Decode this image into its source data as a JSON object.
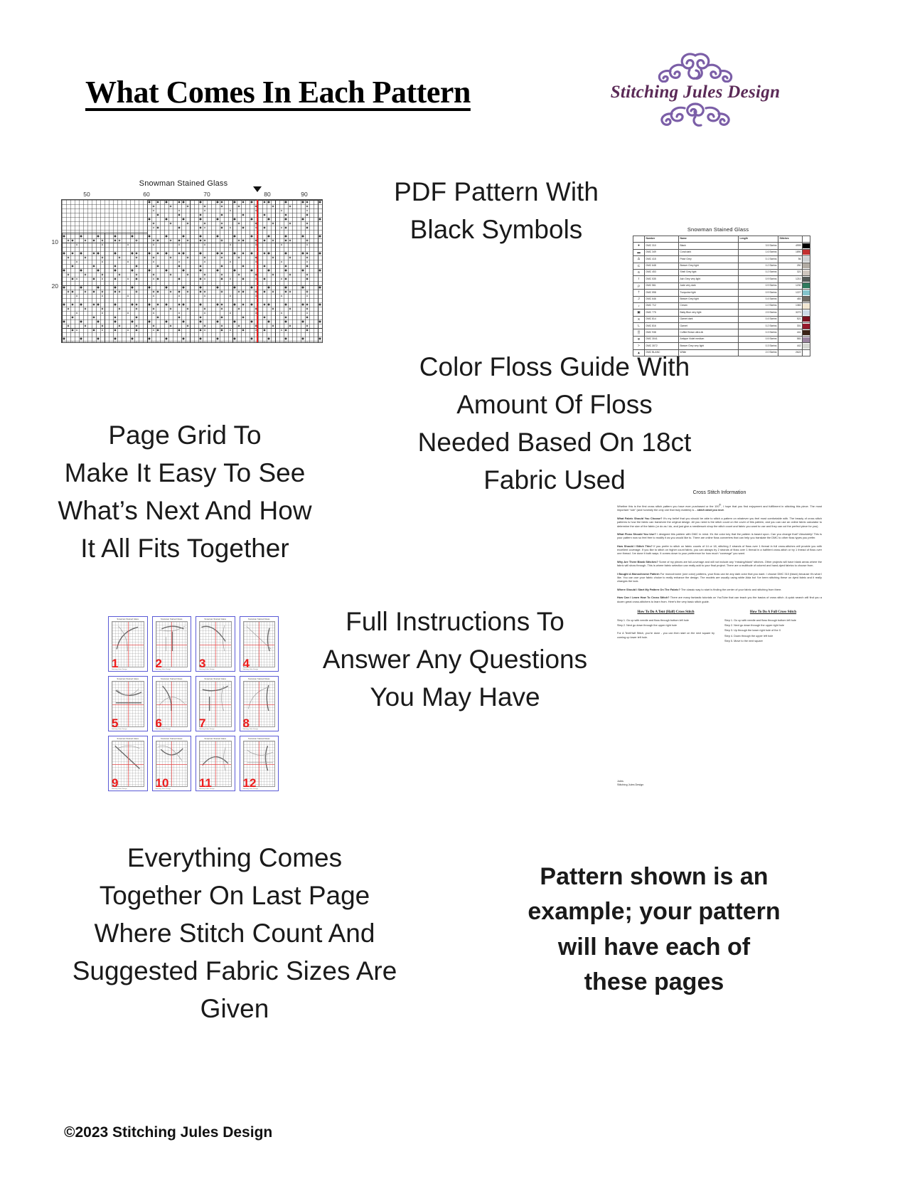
{
  "header": {
    "title": "What Comes In Each Pattern",
    "logo_text": "Stitching Jules Design",
    "logo_color": "#5b2a57",
    "swirl_color": "#7b5ea7"
  },
  "callouts": {
    "pdf_pattern": "PDF Pattern With\nBlack Symbols",
    "page_grid": "Page Grid To\nMake It Easy To See\nWhat’s Next And How\nIt All Fits Together",
    "color_floss": "Color Floss Guide With\nAmount Of Floss\nNeeded Based On 18ct\nFabric Used",
    "full_instructions": "Full Instructions To\nAnswer Any Questions\nYou May Have",
    "everything_comes": "Everything Comes\nTogether On Last Page\nWhere Stitch Count And\nSuggested Fabric Sizes Are\nGiven",
    "disclaimer": "Pattern shown is an\nexample; your pattern\nwill have each of\nthese pages"
  },
  "chart": {
    "title": "Snowman Stained Glass",
    "x_ticks": [
      "50",
      "60",
      "70",
      "80",
      "90"
    ],
    "y_ticks": [
      "10",
      "20"
    ],
    "center_line_color": "#ee1c1c",
    "center_marker_label": "center-marker"
  },
  "floss_table": {
    "title": "Snowman Stained Glass",
    "columns": [
      "",
      "Number",
      "Name",
      "Length",
      "Stitches",
      ""
    ],
    "rows": [
      {
        "symbol": "●",
        "number": "DMC   310",
        "name": "Black",
        "length": "3.5 Skeins",
        "stitches": "4999",
        "color": "#000000"
      },
      {
        "symbol": "▬",
        "number": "DMC   349",
        "name": "Coral dark",
        "length": "1.6 Skeins",
        "stitches": "1890",
        "color": "#c23030"
      },
      {
        "symbol": "∆",
        "number": "DMC   415",
        "name": "Pearl Grey",
        "length": "0.1 Skeins",
        "stitches": "56",
        "color": "#cfd2d4"
      },
      {
        "symbol": "C",
        "number": "DMC   648",
        "name": "Beaver Grey light",
        "length": "0.2 Skeins",
        "stitches": "250",
        "color": "#b2aca4"
      },
      {
        "symbol": "6",
        "number": "DMC   453",
        "name": "Shell Grey light",
        "length": "0.2 Skeins",
        "stitches": "321",
        "color": "#cfc6bf"
      },
      {
        "symbol": "I",
        "number": "DMC   535",
        "name": "Ash Grey very light",
        "length": "0.9 Skeins",
        "stitches": "1210",
        "color": "#555a58"
      },
      {
        "symbol": "ρ",
        "number": "DMC   561",
        "name": "Jade very dark",
        "length": "0.9 Skeins",
        "stitches": "1230",
        "color": "#2f7a5e"
      },
      {
        "symbol": "†",
        "number": "DMC   598",
        "name": "Turquoise light",
        "length": "0.9 Skeins",
        "stitches": "1227",
        "color": "#84c4cc"
      },
      {
        "symbol": "J",
        "number": "DMC   646",
        "name": "Beaver Grey light",
        "length": "0.4 Skeins",
        "stitches": "483",
        "color": "#6e6a63"
      },
      {
        "symbol": "♪",
        "number": "DMC   712",
        "name": "Cream",
        "length": "1.0 Skeins",
        "stitches": "1383",
        "color": "#f2e7d2"
      },
      {
        "symbol": "▣",
        "number": "DMC   775",
        "name": "Baby Blue very light",
        "length": "2.5 Skeins",
        "stitches": "3270",
        "color": "#ccdce8"
      },
      {
        "symbol": "X",
        "number": "DMC   814",
        "name": "Garnet dark",
        "length": "0.4 Skeins",
        "stitches": "521",
        "color": "#7b1220"
      },
      {
        "symbol": "L",
        "number": "DMC   816",
        "name": "Garnet",
        "length": "0.2 Skeins",
        "stitches": "301",
        "color": "#96182a"
      },
      {
        "symbol": "▒",
        "number": "DMC   938",
        "name": "Coffee Brown ultra dk",
        "length": "0.3 Skeins",
        "stitches": "441",
        "color": "#3b2317"
      },
      {
        "symbol": "Φ",
        "number": "DMC   3041",
        "name": "Antique Violet medium",
        "length": "0.5 Skeins",
        "stitches": "583",
        "color": "#9b84a0"
      },
      {
        "symbol": ">",
        "number": "DMC   3072",
        "name": "Beaver Grey very light",
        "length": "0.3 Skeins",
        "stitches": "442",
        "color": "#d6d8d3"
      },
      {
        "symbol": "▲",
        "number": "DMC   BLANC",
        "name": "White",
        "length": "2.0 Skeins",
        "stitches": "2622",
        "color": "#ffffff"
      }
    ]
  },
  "page_grid": {
    "thumb_title": "Snowman Stained Glass",
    "thumb_footer": "Stitching Jules Design",
    "numbers": [
      "1",
      "2",
      "3",
      "4",
      "5",
      "6",
      "7",
      "8",
      "9",
      "10",
      "11",
      "12"
    ],
    "border_color": "#5a5ad6",
    "number_color": "#ee1c1c"
  },
  "instructions_doc": {
    "title": "Cross Stitch Information",
    "lead": "Whether this is the first cross stitch pattern you have ever purchased or the 100th, I hope that you find enjoyment and fulfillment in stitching this piece. The most important “rule” (and honestly the only one that truly matters) is – stitch what you love.",
    "lead_emphasis": "stitch what you love",
    "sections": [
      {
        "question": "What Fabric Should You Choose?",
        "body": " It’s my belief that you should be able to stitch a pattern on whatever you feel most comfortable with. The beauty of cross stitch patterns is how the fabric can transform the original design.  All you need is the stitch count on the cover of this pattern, and you can use an online fabric calculator to determine the size of the fabric (or do as I do, and just give a needlework shop the stitch count and fabric you want to use and they can cut the perfect piece for you)."
      },
      {
        "question": "What Floss Should You Use?",
        "body": " I designed this pattern with DMC in mind. It’s the color key that the pattern is based upon. Can you change that? Absolutely! This is your pattern now so feel free to modify it as you would like to.  There are online floss converters that can help you translate the DMC to other floss types you prefer."
      },
      {
        "question": "How Should I Stitch This?",
        "body": " If you prefer to stitch on fabric counts of 14 or 18, stitching 2 strands of floss over 1 thread in full cross-stitches will provide you with excellent coverage. If you like to stitch on higher count fabric, you can always try 2 strands of floss over 1 thread in a half/tent cross-stitch or try 1 thread of floss over one thread. I’ve done it both ways. It comes down to your preference for how much “coverage” you want."
      },
      {
        "question": "Why Are There Blank Stitches?",
        "body": " Some of my pieces are full-coverage and will not include any “missing/blank” stitches. Other projects will have blank areas where the fabric will show through. This is where fabric selection can really add to your final project. There are a multitude of colored and hand-dyed fabrics to choose from."
      },
      {
        "question": "I Bought A Monochrome Pattern",
        "body": " For monochrome (one color) patterns, your floss can be any dark color that you want. I choose DMC 310 (black) because it’s what I like. You can use your fabric choice to really enhance the design. The models are usually using white Aida but I’ve been stitching these on dyed fabric and it really changes the look."
      },
      {
        "question": "Where Should I Start My Pattern On The Fabric?",
        "body": " The classic way to start is finding the center of your fabric and stitching from there."
      },
      {
        "question": "How Can I Learn How To Cross Stitch?",
        "body": " There are many fantastic tutorials on YouTube that can teach you the basics of cross stitch. A quick search will find you a dozen great cross-stitchers to learn from. Here’s the very basic stitch guide."
      }
    ],
    "guides": [
      {
        "heading": "How To Do A Tent (Half) Cross Stitch",
        "steps": [
          "Step 1. Go up with needle and floss through bottom left hole",
          "Step 2. Next go down through the upper right hole"
        ],
        "note": "For A Tent/Half Stitch, you’re done - you can then start on the next square by coming up lower left hole."
      },
      {
        "heading": "How To Do A Full Cross Stitch",
        "steps": [
          "Step 1. Go up with needle and floss through bottom left hole",
          "Step 2. Next go down through the upper right hole",
          "Step 3. Up through the lower right hole of the X",
          "Step 4. Down through the upper left hole",
          "Step 5. Move to the next square"
        ],
        "note": ""
      }
    ],
    "signature_line1": "Jules",
    "signature_line2": "Stitching Jules Design"
  },
  "footer": {
    "copyright": "©2023 Stitching Jules Design"
  }
}
